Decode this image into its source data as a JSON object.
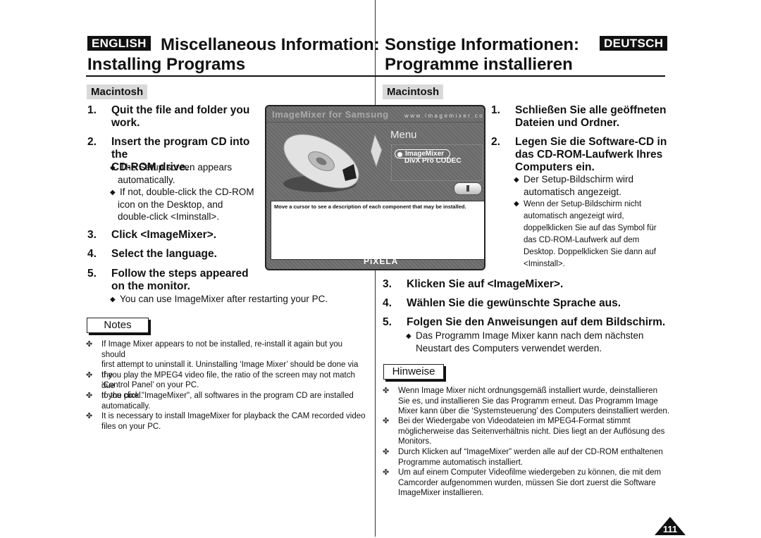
{
  "header": {
    "english_badge": "ENGLISH",
    "deutsch_badge": "DEUTSCH",
    "en_title_line1": "Miscellaneous Information:",
    "en_title_line2": "Installing Programs",
    "de_title_line1": "Sonstige Informationen:",
    "de_title_line2": "Programme installieren"
  },
  "english": {
    "section": "Macintosh",
    "steps": [
      {
        "num": "1.",
        "lines": [
          "Quit the file and folder you",
          "work."
        ]
      },
      {
        "num": "2.",
        "lines": [
          "Insert the program CD into the",
          "CD-ROM drive."
        ],
        "bullets": [
          {
            "lines": [
              "The Setup screen appears",
              "automatically."
            ]
          },
          {
            "lines": [
              "If not, double-click the CD-ROM",
              "icon on the Desktop, and",
              "double-click <Iminstall>."
            ]
          }
        ]
      },
      {
        "num": "3.",
        "lines": [
          "Click <ImageMixer>."
        ]
      },
      {
        "num": "4.",
        "lines": [
          "Select the language."
        ]
      },
      {
        "num": "5.",
        "lines": [
          "Follow the steps appeared",
          "on the monitor."
        ],
        "bullets": [
          {
            "lines": [
              "You can use ImageMixer after restarting your PC."
            ]
          }
        ]
      }
    ],
    "notes_label": "Notes",
    "notes": [
      {
        "lines": [
          "If Image Mixer appears to not be installed, re-install it again but you should",
          "first attempt to uninstall it. Uninstalling ‘Image Mixer’ should be done via the",
          "‘Control Panel’ on your PC."
        ]
      },
      {
        "lines": [
          "If you play the MPEG4 video file, the ratio of the screen may not match due",
          "to the pixel."
        ]
      },
      {
        "lines": [
          "If you click \"ImageMixer\", all softwares in the program CD are installed",
          "automatically."
        ]
      },
      {
        "lines": [
          "It is necessary to install ImageMixer for playback the CAM recorded video",
          "files on your PC."
        ]
      }
    ]
  },
  "deutsch": {
    "section": "Macintosh",
    "steps": [
      {
        "num": "1.",
        "lines": [
          "Schließen Sie alle geöffneten",
          "Dateien und Ordner."
        ]
      },
      {
        "num": "2.",
        "lines": [
          "Legen Sie die Software-CD in",
          "das CD-ROM-Laufwerk Ihres",
          "Computers ein."
        ],
        "bullets": [
          {
            "lines": [
              "Der Setup-Bildschirm wird",
              "automatisch angezeigt."
            ]
          },
          {
            "lines": [
              "Wenn der Setup-Bildschirm nicht",
              "automatisch angezeigt wird,",
              "doppelklicken Sie auf das Symbol für",
              "das CD-ROM-Laufwerk auf dem",
              "Desktop. Doppelklicken Sie dann auf",
              "<Iminstall>."
            ]
          }
        ]
      },
      {
        "num": "3.",
        "lines": [
          "Klicken Sie auf <ImageMixer>."
        ]
      },
      {
        "num": "4.",
        "lines": [
          "Wählen Sie die gewünschte Sprache aus."
        ]
      },
      {
        "num": "5.",
        "lines": [
          "Folgen Sie den Anweisungen auf dem Bildschirm."
        ],
        "bullets": [
          {
            "lines": [
              "Das Programm Image Mixer kann nach dem nächsten",
              "Neustart des Computers verwendet werden."
            ]
          }
        ]
      }
    ],
    "notes_label": "Hinweise",
    "notes": [
      {
        "lines": [
          "Wenn Image Mixer nicht ordnungsgemäß installiert wurde, deinstallieren",
          "Sie es, und installieren Sie das Programm erneut. Das Programm Image",
          "Mixer kann über die ‘Systemsteuerung’ des Computers deinstalliert werden."
        ]
      },
      {
        "lines": [
          "Bei der Wiedergabe von Videodateien im MPEG4-Format stimmt",
          "möglicherweise das Seitenverhältnis nicht. Dies liegt an der Auflösung des",
          "Monitors."
        ]
      },
      {
        "lines": [
          "Durch Klicken auf “ImageMixer” werden alle auf der CD-ROM enthaltenen",
          "Programme automatisch installiert."
        ]
      },
      {
        "lines": [
          "Um auf einem Computer Videofilme wiedergeben zu können, die mit dem",
          "Camcorder aufgenommen wurden, müssen Sie dort zuerst die Software",
          "ImageMixer installieren."
        ]
      }
    ]
  },
  "screenshot": {
    "title": "ImageMixer for Samsung",
    "url": "www.imagemixer.com",
    "menu_title": "Menu",
    "menu_items": [
      "ImageMixer",
      "DivX Pro CODEC"
    ],
    "description": "Move a cursor to see a description of each component that may be installed.",
    "logo": "PiXELA"
  },
  "page_number": "111"
}
